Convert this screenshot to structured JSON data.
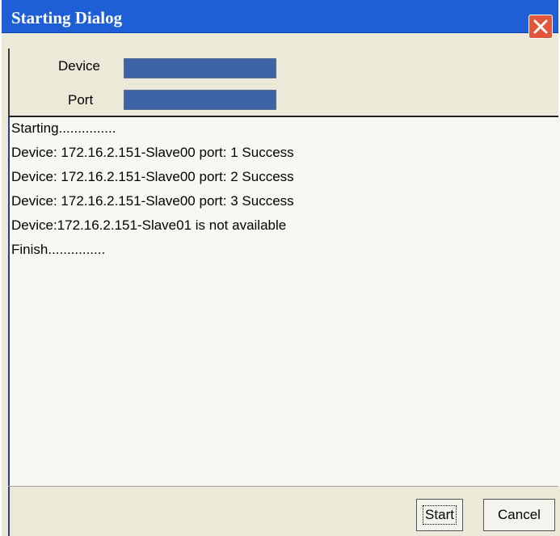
{
  "window": {
    "title": "Starting Dialog"
  },
  "header": {
    "device_label": "Device",
    "port_label": "Port"
  },
  "log": {
    "lines": [
      "Starting...............",
      "Device: 172.16.2.151-Slave00 port: 1 Success",
      "Device: 172.16.2.151-Slave00 port: 2 Success",
      "Device: 172.16.2.151-Slave00 port: 3 Success",
      "Device:172.16.2.151-Slave01 is not available",
      "Finish..............."
    ]
  },
  "buttons": {
    "start_label": "Start",
    "cancel_label": "Cancel"
  },
  "icons": {
    "close": "close-icon"
  },
  "colors": {
    "titlebar": "#1f5fd6",
    "progress": "#3d63a5",
    "close_button": "#e2573b"
  }
}
